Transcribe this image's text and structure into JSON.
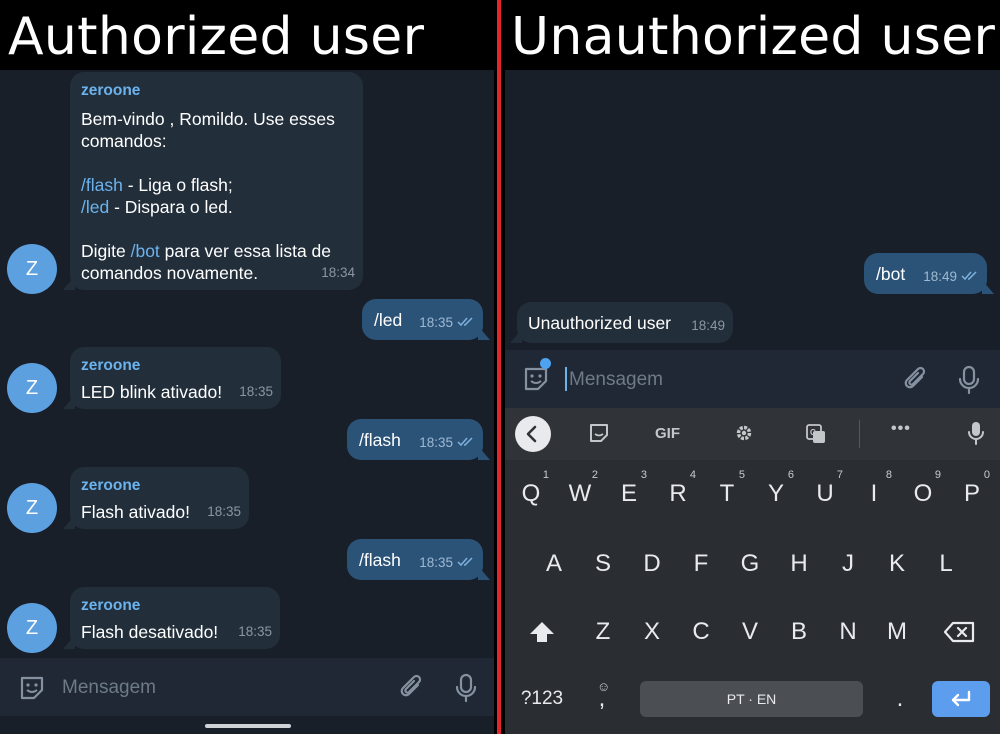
{
  "captions": {
    "left": "Authorized user",
    "right": "Unauthorized user"
  },
  "colors": {
    "chat_bg": "#181f29",
    "incoming": "#222e3a",
    "outgoing": "#2b5378",
    "accent": "#6cb3ee",
    "divider": "#e3262b",
    "keyboard": "#2a2d31"
  },
  "left": {
    "messages": [
      {
        "direction": "in",
        "sender": "zeroone",
        "avatar": "Z",
        "greeting": "Bem-vindo , Romildo. Use esses comandos:",
        "cmd1": "/flash",
        "cmd1_desc": " - Liga o flash;",
        "cmd2": "/led",
        "cmd2_desc": " - Dispara o led.",
        "footer_pre": "Digite ",
        "footer_cmd": "/bot",
        "footer_post": " para ver essa lista de comandos novamente.",
        "time": "18:34"
      },
      {
        "direction": "out",
        "text": "/led",
        "time": "18:35"
      },
      {
        "direction": "in",
        "sender": "zeroone",
        "avatar": "Z",
        "text": "LED blink ativado!",
        "time": "18:35"
      },
      {
        "direction": "out",
        "text": "/flash",
        "time": "18:35"
      },
      {
        "direction": "in",
        "sender": "zeroone",
        "avatar": "Z",
        "text": "Flash ativado!",
        "time": "18:35"
      },
      {
        "direction": "out",
        "text": "/flash",
        "time": "18:35"
      },
      {
        "direction": "in",
        "sender": "zeroone",
        "avatar": "Z",
        "text": "Flash desativado!",
        "time": "18:35"
      }
    ],
    "composer": {
      "placeholder": "Mensagem",
      "icons": [
        "sticker-icon",
        "attach-icon",
        "mic-icon"
      ]
    }
  },
  "right": {
    "messages": [
      {
        "direction": "out",
        "text": "/bot",
        "time": "18:49"
      },
      {
        "direction": "in",
        "text": "Unauthorized user",
        "time": "18:49"
      }
    ],
    "composer": {
      "placeholder": "Mensagem",
      "icons": [
        "sticker-icon",
        "attach-icon",
        "mic-icon"
      ]
    },
    "keyboard": {
      "toolbar": {
        "gif": "GIF",
        "icons": [
          "back-icon",
          "sticker-icon",
          "gif-icon",
          "settings-icon",
          "translate-icon",
          "more-icon",
          "mic-icon"
        ],
        "more": "•••"
      },
      "row1": [
        "Q",
        "W",
        "E",
        "R",
        "T",
        "Y",
        "U",
        "I",
        "O",
        "P"
      ],
      "row1_hints": [
        "1",
        "2",
        "3",
        "4",
        "5",
        "6",
        "7",
        "8",
        "9",
        "0"
      ],
      "row2": [
        "A",
        "S",
        "D",
        "F",
        "G",
        "H",
        "J",
        "K",
        "L"
      ],
      "row3": [
        "Z",
        "X",
        "C",
        "V",
        "B",
        "N",
        "M"
      ],
      "symbols": "?123",
      "comma": ",",
      "space": "PT · EN",
      "period": "."
    }
  }
}
